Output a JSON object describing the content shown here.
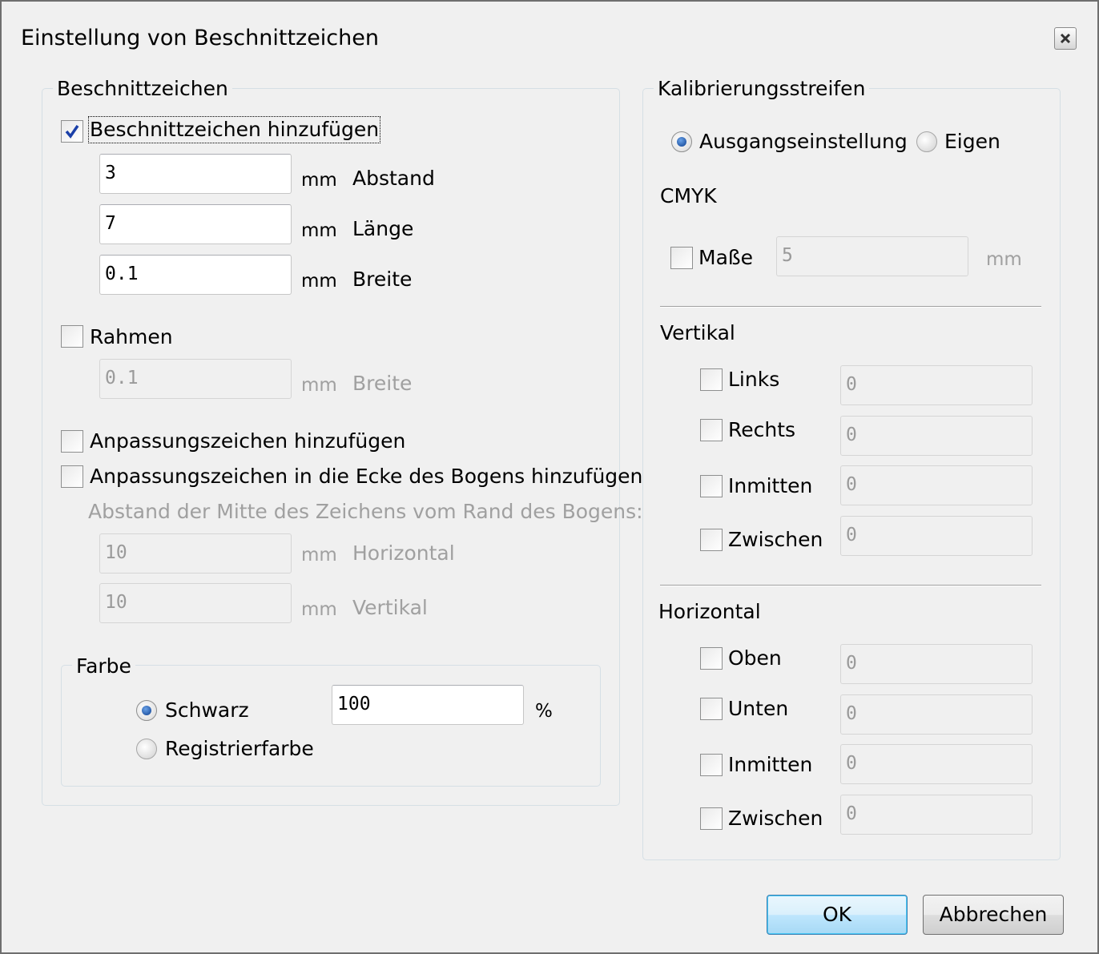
{
  "window": {
    "title": "Einstellung von Beschnittzeichen"
  },
  "crop_marks": {
    "legend": "Beschnittzeichen",
    "add_checkbox": {
      "label": "Beschnittzeichen hinzufügen",
      "checked": true
    },
    "fields": [
      {
        "value": "3",
        "unit": "mm",
        "label": "Abstand"
      },
      {
        "value": "7",
        "unit": "mm",
        "label": "Länge"
      },
      {
        "value": "0.1",
        "unit": "mm",
        "label": "Breite"
      }
    ],
    "frame_checkbox": {
      "label": "Rahmen",
      "checked": false
    },
    "frame_width": {
      "value": "0.1",
      "unit": "mm",
      "label": "Breite"
    },
    "adjust_checkbox": {
      "label": "Anpassungszeichen hinzufügen",
      "checked": false
    },
    "adjust_corner_checkbox": {
      "label": "Anpassungszeichen in die Ecke des Bogens hinzufügen",
      "checked": false
    },
    "distance_note": "Abstand der Mitte des Zeichens vom Rand des Bogens:",
    "horizontal": {
      "value": "10",
      "unit": "mm",
      "label": "Horizontal"
    },
    "vertical": {
      "value": "10",
      "unit": "mm",
      "label": "Vertikal"
    },
    "color": {
      "legend": "Farbe",
      "black_radio": {
        "label": "Schwarz",
        "selected": true
      },
      "black_percent": {
        "value": "100",
        "unit": "%"
      },
      "registration_radio": {
        "label": "Registrierfarbe",
        "selected": false
      }
    }
  },
  "calibration": {
    "legend": "Kalibrierungsstreifen",
    "default_radio": {
      "label": "Ausgangseinstellung",
      "selected": true
    },
    "custom_radio": {
      "label": "Eigen",
      "selected": false
    },
    "cmyk_heading": "CMYK",
    "size_checkbox": {
      "label": "Maße",
      "checked": false
    },
    "size_value": "5",
    "size_unit": "mm",
    "vertical_heading": "Vertikal",
    "vertical_items": [
      {
        "label": "Links",
        "value": "0"
      },
      {
        "label": "Rechts",
        "value": "0"
      },
      {
        "label": "Inmitten",
        "value": "0"
      },
      {
        "label": "Zwischen",
        "value": "0"
      }
    ],
    "horizontal_heading": "Horizontal",
    "horizontal_items": [
      {
        "label": "Oben",
        "value": "0"
      },
      {
        "label": "Unten",
        "value": "0"
      },
      {
        "label": "Inmitten",
        "value": "0"
      },
      {
        "label": "Zwischen",
        "value": "0"
      }
    ]
  },
  "buttons": {
    "ok": "OK",
    "cancel": "Abbrechen"
  },
  "icons": {
    "close": "close-icon",
    "check": "checkmark-icon"
  }
}
